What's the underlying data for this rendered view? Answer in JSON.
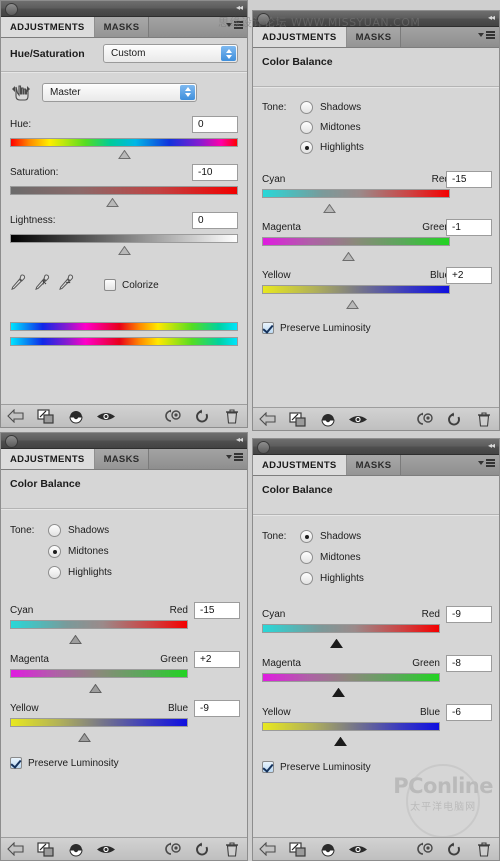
{
  "window": {
    "tabs": {
      "adjustments": "ADJUSTMENTS",
      "masks": "MASKS"
    },
    "menu_icon": "panel-menu-icon",
    "collapse_icon": "collapse-to-icons-icon"
  },
  "footer": {
    "icons": [
      {
        "name": "return-to-adjustment-list-icon",
        "glyph": "arrow-left"
      },
      {
        "name": "clip-to-layer-icon",
        "glyph": "clip"
      },
      {
        "name": "toggle-layer-visibility-icon",
        "glyph": "halfball"
      },
      {
        "name": "preview-eye-icon",
        "glyph": "eye"
      },
      {
        "name": "view-previous-state-icon",
        "glyph": "prevstate"
      },
      {
        "name": "reset-adjustment-icon",
        "glyph": "reset"
      },
      {
        "name": "delete-adjustment-layer-icon",
        "glyph": "trash"
      }
    ]
  },
  "panels": [
    {
      "id": "hue-saturation",
      "title": "Hue/Saturation",
      "preset_value": "Custom",
      "channel_value": "Master",
      "targeted_adjustment_icon": "targeted-adjustment-tool-icon",
      "sliders": [
        {
          "label": "Hue:",
          "value": "0",
          "pos": 50
        },
        {
          "label": "Saturation:",
          "value": "-10",
          "pos": 45
        },
        {
          "label": "Lightness:",
          "value": "0",
          "pos": 50
        }
      ],
      "eyedroppers": [
        {
          "name": "eyedropper-sample-icon"
        },
        {
          "name": "eyedropper-add-to-sample-icon"
        },
        {
          "name": "eyedropper-subtract-from-sample-icon"
        }
      ],
      "colorize": {
        "label": "Colorize",
        "checked": false
      }
    },
    {
      "id": "color-balance-highlights",
      "title": "Color Balance",
      "tone_label": "Tone:",
      "tones": [
        {
          "label": "Shadows",
          "selected": false
        },
        {
          "label": "Midtones",
          "selected": false
        },
        {
          "label": "Highlights",
          "selected": true
        }
      ],
      "sliders": [
        {
          "left": "Cyan",
          "right": "Red",
          "value": "-15",
          "pos": 39,
          "style": "gray"
        },
        {
          "left": "Magenta",
          "right": "Green",
          "value": "-1",
          "pos": 49,
          "style": "gray"
        },
        {
          "left": "Yellow",
          "right": "Blue",
          "value": "+2",
          "pos": 51,
          "style": "gray"
        }
      ],
      "preserve": {
        "label": "Preserve Luminosity",
        "checked": true
      }
    },
    {
      "id": "color-balance-midtones",
      "title": "Color Balance",
      "tone_label": "Tone:",
      "tones": [
        {
          "label": "Shadows",
          "selected": false
        },
        {
          "label": "Midtones",
          "selected": true
        },
        {
          "label": "Highlights",
          "selected": false
        }
      ],
      "sliders": [
        {
          "left": "Cyan",
          "right": "Red",
          "value": "-15",
          "pos": 40,
          "style": "dark"
        },
        {
          "left": "Magenta",
          "right": "Green",
          "value": "+2",
          "pos": 51,
          "style": "dark"
        },
        {
          "left": "Yellow",
          "right": "Blue",
          "value": "-9",
          "pos": 45,
          "style": "dark"
        }
      ],
      "preserve": {
        "label": "Preserve Luminosity",
        "checked": true
      }
    },
    {
      "id": "color-balance-shadows",
      "title": "Color Balance",
      "tone_label": "Tone:",
      "tones": [
        {
          "label": "Shadows",
          "selected": true
        },
        {
          "label": "Midtones",
          "selected": false
        },
        {
          "label": "Highlights",
          "selected": false
        }
      ],
      "sliders": [
        {
          "left": "Cyan",
          "right": "Red",
          "value": "-9",
          "pos": 45,
          "style": "black"
        },
        {
          "left": "Magenta",
          "right": "Green",
          "value": "-8",
          "pos": 46,
          "style": "black"
        },
        {
          "left": "Yellow",
          "right": "Blue",
          "value": "-6",
          "pos": 47,
          "style": "black"
        }
      ],
      "preserve": {
        "label": "Preserve Luminosity",
        "checked": true
      }
    }
  ],
  "watermarks": {
    "forum": "思缘设计论坛 WWW.MISSYUAN.COM",
    "pconline_name": "PConline",
    "pconline_cn": "太平洋电脑网"
  }
}
